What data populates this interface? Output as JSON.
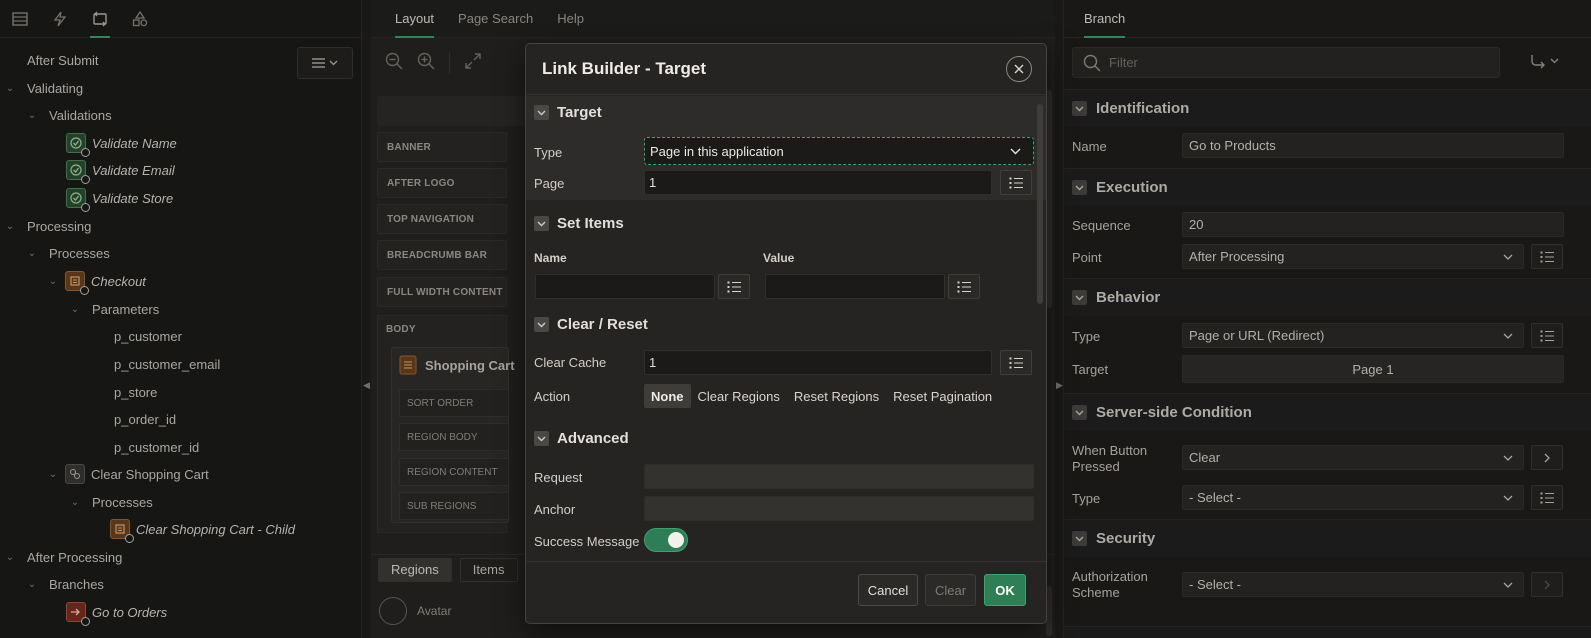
{
  "left_panel": {
    "toolbar_icons": [
      "list-icon",
      "lightning-icon",
      "refresh-icon",
      "shapes-icon"
    ],
    "menu_button_icon": "hamburger-icon",
    "tree": [
      {
        "label": "After Submit",
        "level": 0
      },
      {
        "label": "Validating",
        "level": 0
      },
      {
        "label": "Validations",
        "level": 1
      },
      {
        "label": "Validate Name",
        "level": 2
      },
      {
        "label": "Validate Email",
        "level": 2
      },
      {
        "label": "Validate Store",
        "level": 2
      },
      {
        "label": "Processing",
        "level": 0
      },
      {
        "label": "Processes",
        "level": 1
      },
      {
        "label": "Checkout",
        "level": 2
      },
      {
        "label": "Parameters",
        "level": 3
      },
      {
        "label": "p_customer",
        "level": 4
      },
      {
        "label": "p_customer_email",
        "level": 4
      },
      {
        "label": "p_store",
        "level": 4
      },
      {
        "label": "p_order_id",
        "level": 4
      },
      {
        "label": "p_customer_id",
        "level": 4
      },
      {
        "label": "Clear Shopping Cart",
        "level": 2
      },
      {
        "label": "Processes",
        "level": 3
      },
      {
        "label": "Clear Shopping Cart - Child",
        "level": 4
      },
      {
        "label": "After Processing",
        "level": 0
      },
      {
        "label": "Branches",
        "level": 1
      },
      {
        "label": "Go to Orders",
        "level": 2
      }
    ]
  },
  "middle": {
    "tabs": [
      "Layout",
      "Page Search",
      "Help"
    ],
    "positions": [
      "BANNER",
      "AFTER LOGO",
      "TOP NAVIGATION",
      "BREADCRUMB BAR",
      "FULL WIDTH CONTENT",
      "BODY"
    ],
    "region_title": "Shopping Cart",
    "sub_positions": [
      "SORT ORDER",
      "REGION BODY",
      "REGION CONTENT",
      "SUB REGIONS"
    ],
    "bottom_tabs": [
      "Regions",
      "Items"
    ],
    "gallery_first": "Avatar"
  },
  "right_panel": {
    "tab": "Branch",
    "filter_placeholder": "Filter",
    "sections": {
      "identification": {
        "title": "Identification",
        "name_label": "Name",
        "name_value": "Go to Products"
      },
      "execution": {
        "title": "Execution",
        "sequence_label": "Sequence",
        "sequence_value": "20",
        "point_label": "Point",
        "point_value": "After Processing"
      },
      "behavior": {
        "title": "Behavior",
        "type_label": "Type",
        "type_value": "Page or URL (Redirect)",
        "target_label": "Target",
        "target_value": "Page 1"
      },
      "condition": {
        "title": "Server-side Condition",
        "when_label_1": "When Button",
        "when_label_2": "Pressed",
        "when_value": "Clear",
        "type_label": "Type",
        "type_value": "- Select -"
      },
      "security": {
        "title": "Security",
        "auth_label_1": "Authorization",
        "auth_label_2": "Scheme",
        "auth_value": "- Select -"
      }
    }
  },
  "dialog": {
    "title": "Link Builder - Target",
    "target": {
      "title": "Target",
      "type_label": "Type",
      "type_value": "Page in this application",
      "page_label": "Page",
      "page_value": "1"
    },
    "set_items": {
      "title": "Set Items",
      "name_header": "Name",
      "value_header": "Value"
    },
    "clear_reset": {
      "title": "Clear / Reset",
      "cache_label": "Clear Cache",
      "cache_value": "1",
      "action_label": "Action",
      "action_options": [
        "None",
        "Clear Regions",
        "Reset Regions",
        "Reset Pagination"
      ],
      "action_selected": "None"
    },
    "advanced": {
      "title": "Advanced",
      "request_label": "Request",
      "request_value": "",
      "anchor_label": "Anchor",
      "anchor_value": "",
      "success_label": "Success Message",
      "success_on": true
    },
    "buttons": {
      "cancel": "Cancel",
      "clear": "Clear",
      "ok": "OK"
    }
  },
  "colors": {
    "accent": "#3aa46e",
    "ok_button": "#2e7f56",
    "background": "#201f1e"
  }
}
